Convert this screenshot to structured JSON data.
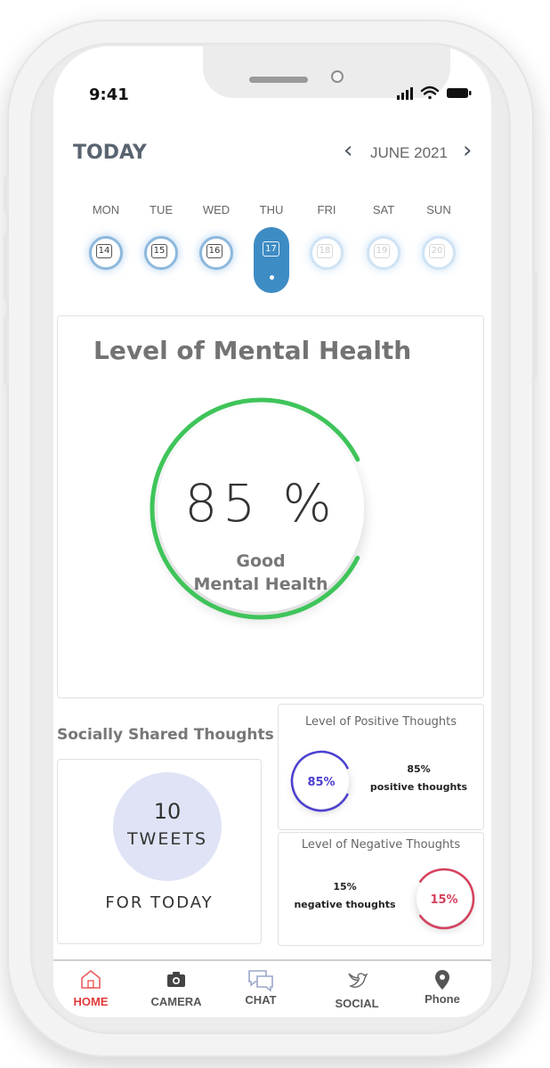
{
  "status_bar": {
    "time": "9:41"
  },
  "header": {
    "title": "TODAY",
    "month": "JUNE 2021",
    "prev_icon": "chevron-left-icon",
    "next_icon": "chevron-right-icon"
  },
  "week": {
    "days": [
      {
        "name": "MON",
        "date": "14",
        "state": "past"
      },
      {
        "name": "TUE",
        "date": "15",
        "state": "past"
      },
      {
        "name": "WED",
        "date": "16",
        "state": "past"
      },
      {
        "name": "THU",
        "date": "17",
        "state": "selected"
      },
      {
        "name": "FRI",
        "date": "18",
        "state": "future"
      },
      {
        "name": "SAT",
        "date": "19",
        "state": "future"
      },
      {
        "name": "SUN",
        "date": "20",
        "state": "future"
      }
    ]
  },
  "mental_health": {
    "title": "Level of Mental Health",
    "value": "85 %",
    "percent": 0.85,
    "label_line1": "Good",
    "label_line2": "Mental Health",
    "color": "#3fc45a"
  },
  "shared": {
    "title": "Socially Shared Thoughts",
    "count": "10",
    "unit": "TWEETS",
    "caption": "FOR TODAY"
  },
  "positive": {
    "title": "Level of Positive Thoughts",
    "ring_value": "85%",
    "percent_text": "85%",
    "caption": "positive thoughts",
    "percent": 0.85,
    "color": "#4b3fd1"
  },
  "negative": {
    "title": "Level of Negative Thoughts",
    "ring_value": "15%",
    "percent_text": "15%",
    "caption": "negative thoughts",
    "percent": 0.15,
    "color": "#d6405c"
  },
  "tabbar": {
    "items": [
      {
        "label": "HOME",
        "icon": "home-icon",
        "active": true
      },
      {
        "label": "CAMERA",
        "icon": "camera-icon",
        "active": false
      },
      {
        "label": "CHAT",
        "icon": "chat-icon",
        "active": false
      },
      {
        "label": "SOCIAL",
        "icon": "bird-icon",
        "active": false
      },
      {
        "label": "Phone",
        "icon": "location-pin-icon",
        "active": false
      }
    ]
  }
}
